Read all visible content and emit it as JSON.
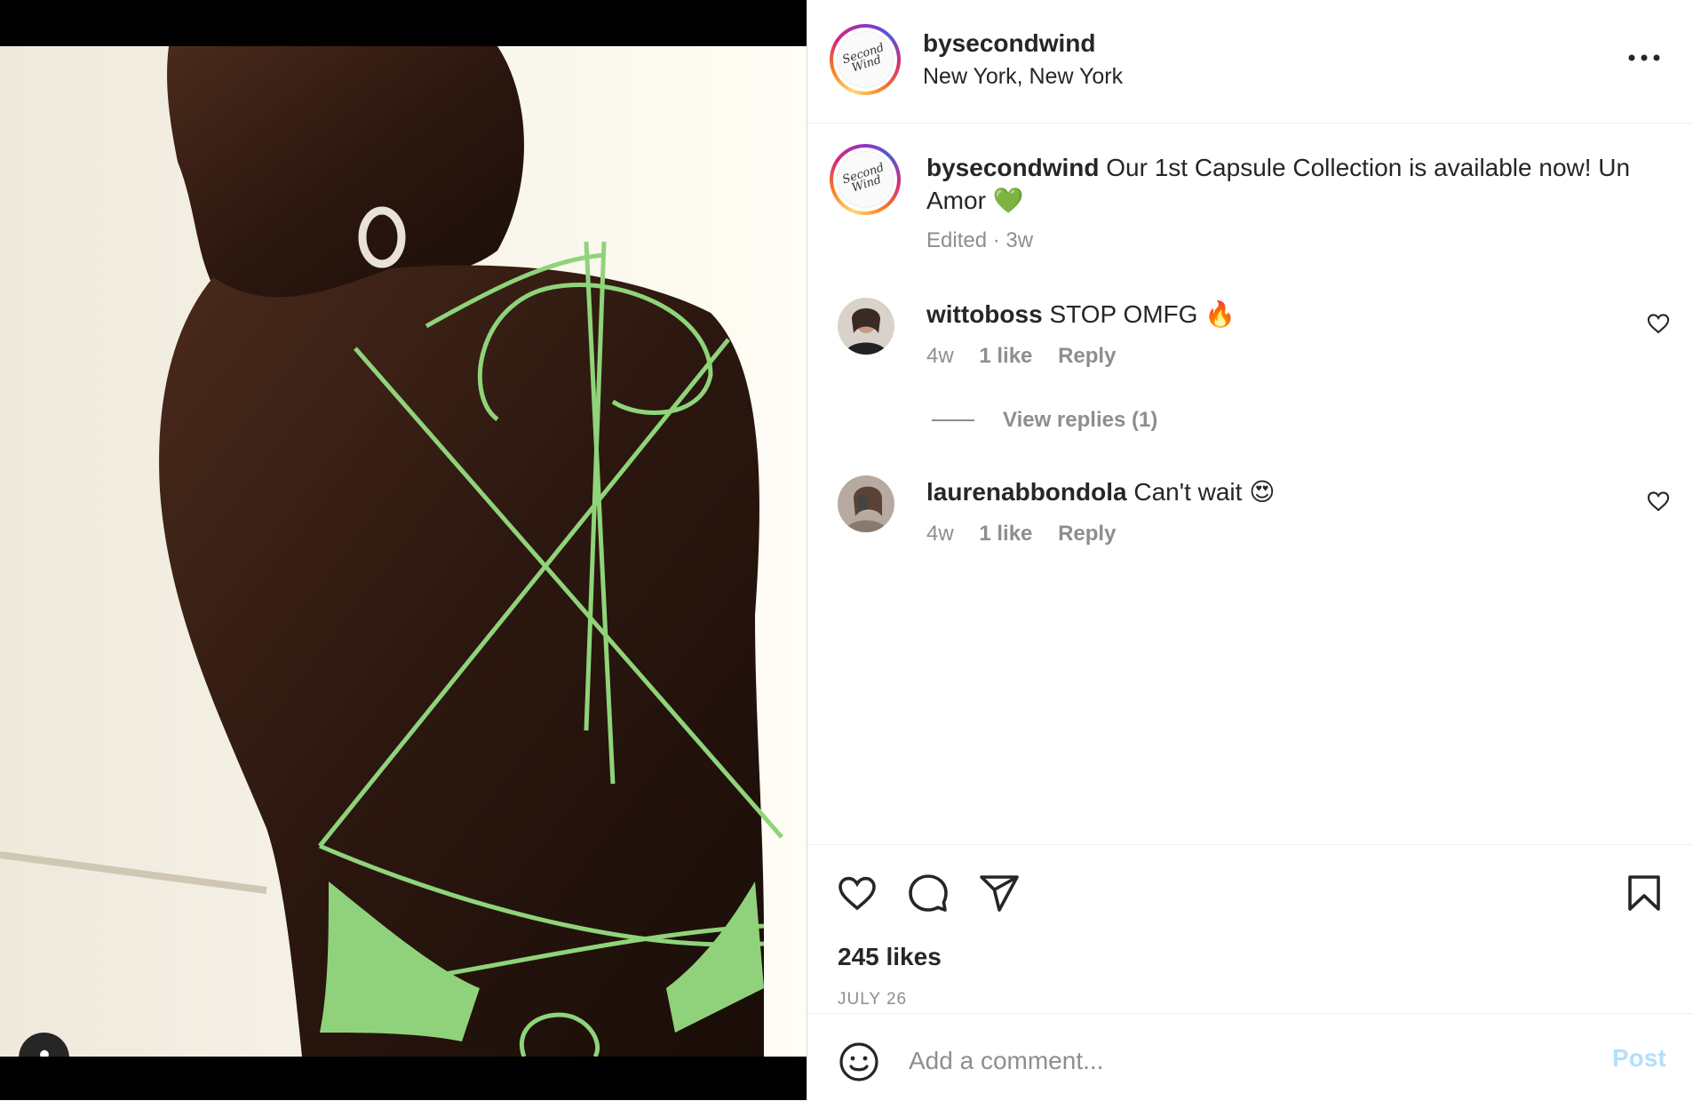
{
  "post": {
    "username": "bysecondwind",
    "location": "New York, New York",
    "avatar_logo_text": "Second\nWind",
    "caption": "Our 1st Capsule Collection is available now! Un Amor",
    "caption_emoji": "💚",
    "caption_meta": "Edited · 3w",
    "likes": "245 likes",
    "date": "JULY 26"
  },
  "comments": [
    {
      "username": "wittoboss",
      "text": "STOP OMFG",
      "emoji": "🔥",
      "age": "4w",
      "likes": "1 like",
      "reply": "Reply"
    },
    {
      "username": "laurenabbondola",
      "text": "Can't wait",
      "emoji": "😍",
      "age": "4w",
      "likes": "1 like",
      "reply": "Reply"
    }
  ],
  "view_replies": "View replies (1)",
  "comment_box": {
    "placeholder": "Add a comment...",
    "post_label": "Post"
  },
  "icons": {
    "more": "more-options-icon",
    "like": "heart-icon",
    "comment": "comment-bubble-icon",
    "share": "paper-plane-icon",
    "save": "bookmark-icon",
    "emoji": "smiley-icon",
    "user_tag": "person-icon"
  },
  "colors": {
    "text": "#262626",
    "secondary": "#8e8e8e",
    "post_button_disabled": "#b2dffc",
    "strap_green": "#8fd47a"
  }
}
